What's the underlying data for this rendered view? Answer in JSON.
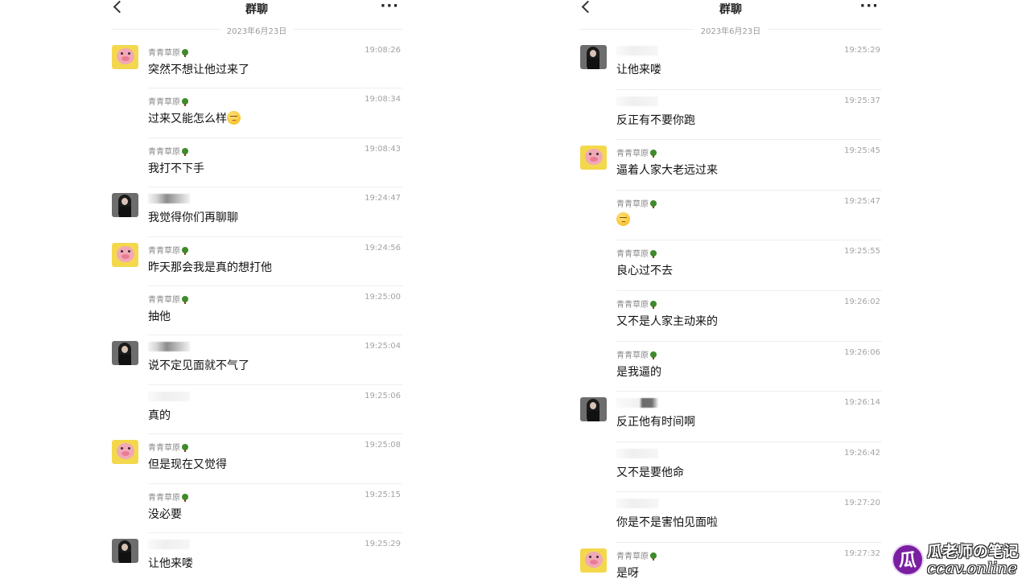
{
  "left": {
    "title": "群聊",
    "date": "2023年6月23日",
    "messages": [
      {
        "avatar": "pig",
        "name": "青青草原",
        "tree": true,
        "time": "19:08:26",
        "text": "突然不想让他过来了",
        "emoji": false
      },
      {
        "avatar": "",
        "name": "青青草原",
        "tree": true,
        "time": "19:08:34",
        "text": "过来又能怎么样",
        "emoji": true
      },
      {
        "avatar": "",
        "name": "青青草原",
        "tree": true,
        "time": "19:08:43",
        "text": "我打不下手",
        "emoji": false
      },
      {
        "avatar": "girl",
        "name": "",
        "blur": "dark",
        "time": "19:24:47",
        "text": "我觉得你们再聊聊",
        "emoji": false
      },
      {
        "avatar": "pig",
        "name": "青青草原",
        "tree": true,
        "time": "19:24:56",
        "text": "昨天那会我是真的想打他",
        "emoji": false
      },
      {
        "avatar": "",
        "name": "青青草原",
        "tree": true,
        "time": "19:25:00",
        "text": "抽他",
        "emoji": false
      },
      {
        "avatar": "girl",
        "name": "",
        "blur": "dark",
        "time": "19:25:04",
        "text": "说不定见面就不气了",
        "emoji": false
      },
      {
        "avatar": "",
        "name": "",
        "blur": "faint",
        "time": "19:25:06",
        "text": "真的",
        "emoji": false
      },
      {
        "avatar": "pig",
        "name": "青青草原",
        "tree": true,
        "time": "19:25:08",
        "text": "但是现在又觉得",
        "emoji": false
      },
      {
        "avatar": "",
        "name": "青青草原",
        "tree": true,
        "time": "19:25:15",
        "text": "没必要",
        "emoji": false
      },
      {
        "avatar": "girl",
        "name": "",
        "blur": "faint",
        "time": "19:25:29",
        "text": "让他来喽",
        "emoji": false
      }
    ]
  },
  "right": {
    "title": "群聊",
    "date": "2023年6月23日",
    "messages": [
      {
        "avatar": "girl",
        "name": "",
        "blur": "faint",
        "time": "19:25:29",
        "text": "让他来喽",
        "emoji": false
      },
      {
        "avatar": "",
        "name": "",
        "blur": "faint",
        "time": "19:25:37",
        "text": "反正有不要你跑",
        "emoji": false
      },
      {
        "avatar": "pig",
        "name": "青青草原",
        "tree": true,
        "time": "19:25:45",
        "text": "逼着人家大老远过来",
        "emoji": false
      },
      {
        "avatar": "",
        "name": "青青草原",
        "tree": true,
        "time": "19:25:47",
        "text": "",
        "emoji": true
      },
      {
        "avatar": "",
        "name": "青青草原",
        "tree": true,
        "time": "19:25:55",
        "text": "良心过不去",
        "emoji": false
      },
      {
        "avatar": "",
        "name": "青青草原",
        "tree": true,
        "time": "19:26:02",
        "text": "又不是人家主动来的",
        "emoji": false
      },
      {
        "avatar": "",
        "name": "青青草原",
        "tree": true,
        "time": "19:26:06",
        "text": "是我逼的",
        "emoji": false
      },
      {
        "avatar": "girl",
        "name": "",
        "blur": "box",
        "time": "19:26:14",
        "text": "反正他有时间啊",
        "emoji": false
      },
      {
        "avatar": "",
        "name": "",
        "blur": "faint",
        "time": "19:26:42",
        "text": "又不是要他命",
        "emoji": false
      },
      {
        "avatar": "",
        "name": "",
        "blur": "faint",
        "time": "19:27:20",
        "text": "你是不是害怕见面啦",
        "emoji": false
      },
      {
        "avatar": "pig",
        "name": "青青草原",
        "tree": true,
        "time": "19:27:32",
        "text": "是呀",
        "emoji": false
      }
    ]
  },
  "watermark": {
    "logo_char": "瓜",
    "title": "瓜老师の笔记",
    "url": "ccav.online"
  }
}
